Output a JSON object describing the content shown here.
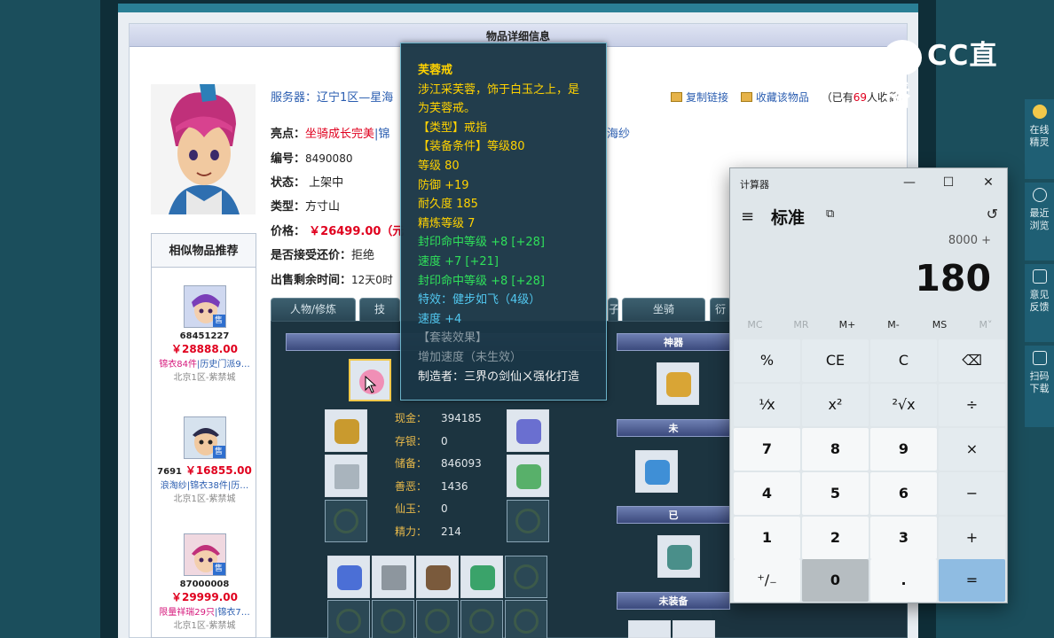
{
  "detail": {
    "header": "物品详细信息"
  },
  "info": {
    "server": "服务器：辽宁1区—星海",
    "highlights_label": "亮点：",
    "highlights_a": "坐骑成长完美",
    "highlights_b": "|锦",
    "highlights_tail": "海纱",
    "id_label": "编号：",
    "id_value": "8490080",
    "status_label": "状态：",
    "status_value": "上架中",
    "type_label": "类型：",
    "type_value": "方寸山",
    "price_label": "价格：",
    "price_value": "￥26499.00（元",
    "bargain_label": "是否接受还价：",
    "bargain_value": "拒绝",
    "remain_label": "出售剩余时间：",
    "remain_value": "12天0时"
  },
  "links": {
    "copy": "复制链接",
    "favorite": "收藏该物品",
    "fav_prefix": "（已有",
    "fav_count": "69",
    "fav_suffix": "人收藏）"
  },
  "similar": {
    "title": "相似物品推荐",
    "badge": "售",
    "items": [
      {
        "id": "68451227",
        "price": "￥28888.00",
        "tags_a": "锦衣84件",
        "tags_b": "|历史门派9…",
        "server": "北京1区-紫禁城"
      },
      {
        "id": "7691",
        "price": "￥16855.00",
        "tags_a": "",
        "tags_b": "浪淘纱|锦衣38件|历…",
        "server": "北京1区-紫禁城"
      },
      {
        "id": "87000008",
        "price": "￥29999.00",
        "tags_a": "限量祥瑞29只",
        "tags_b": "|锦衣7…",
        "server": "北京1区-紫禁城"
      }
    ]
  },
  "tabs": {
    "t1": "人物/修炼",
    "t2": "技",
    "t3": "子",
    "t4": "坐骑",
    "t5": "衍"
  },
  "game": {
    "bar_shenqi": "神器",
    "bar_wei": "未",
    "bar_yi": "已",
    "bar_weizhuang": "未装备",
    "stats": [
      {
        "k": "现金：",
        "v": "394185"
      },
      {
        "k": "存银：",
        "v": "0"
      },
      {
        "k": "储备：",
        "v": "846093"
      },
      {
        "k": "善恶：",
        "v": "1436"
      },
      {
        "k": "仙玉：",
        "v": "0"
      },
      {
        "k": "精力：",
        "v": "214"
      }
    ]
  },
  "tooltip": {
    "name": "芙蓉戒",
    "desc1": "涉江采芙蓉，饰于白玉之上，是",
    "desc2": "为芙蓉戒。",
    "type": "【类型】戒指",
    "req": "【装备条件】等级80",
    "level": "等级 80",
    "defense": "防御 +19",
    "durability": "耐久度 185",
    "refine": "精炼等级 7",
    "seal_hit": "封印命中等级 +8 [+28]",
    "speed_line": "速度 +7 [+21]",
    "seal_hit2": "封印命中等级 +8 [+28]",
    "effect": "特效：健步如飞（4级）",
    "speed": "速度 +4",
    "set_effect": "【套装效果】",
    "set_detail": "增加速度（未生效）",
    "maker": "制造者：三界の剑仙ㄨ强化打造"
  },
  "logo": {
    "text": "CC直播"
  },
  "side_panel": [
    {
      "label": "在线精灵",
      "icon": "fairy-icon"
    },
    {
      "label": "最近浏览",
      "icon": "clock-icon"
    },
    {
      "label": "意见反馈",
      "icon": "edit-icon"
    },
    {
      "label": "扫码下载",
      "icon": "scan-icon"
    }
  ],
  "calculator": {
    "title": "计算器",
    "minimize": "—",
    "maximize": "☐",
    "close": "✕",
    "menu": "≡",
    "mode": "标准",
    "keep_on_top": "⧉",
    "history": "↺",
    "expression": "8000 +",
    "display": "180",
    "memory": [
      "MC",
      "MR",
      "M+",
      "M-",
      "MS",
      "M˅"
    ],
    "keys": [
      "%",
      "CE",
      "C",
      "⌫",
      "⅟x",
      "x²",
      "²√x",
      "÷",
      "7",
      "8",
      "9",
      "×",
      "4",
      "5",
      "6",
      "−",
      "1",
      "2",
      "3",
      "+",
      "⁺∕₋",
      "0",
      ".",
      "="
    ]
  },
  "colors": {
    "accent": "#e0001e",
    "link": "#2a5db0",
    "panel": "#1c3440",
    "equals": "#8fbce2"
  }
}
